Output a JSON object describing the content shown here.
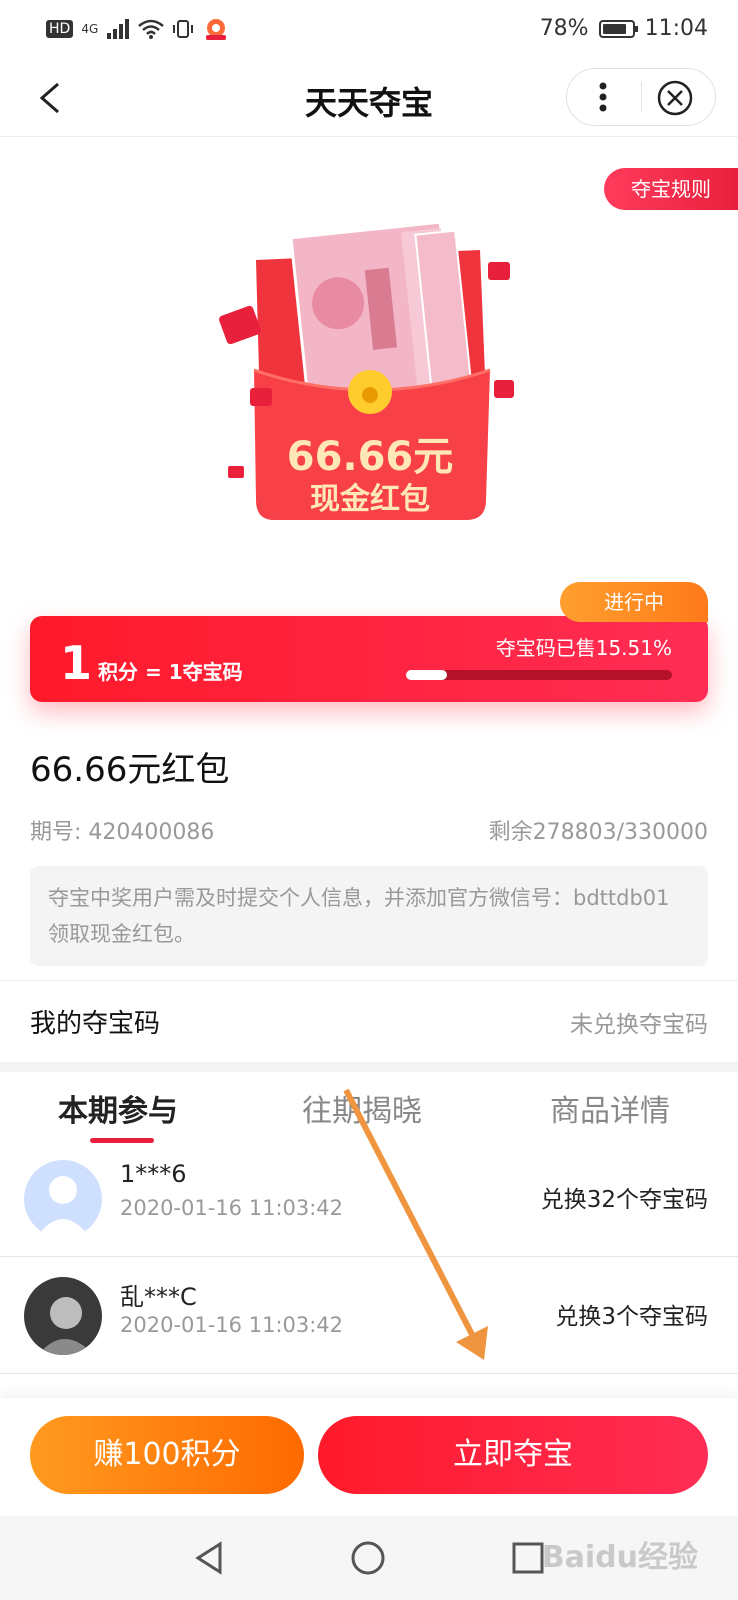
{
  "status_bar": {
    "network": "HD",
    "signal": "4G",
    "battery": "78%",
    "time": "11:04"
  },
  "nav": {
    "title": "天天夺宝"
  },
  "hero": {
    "rules_label": "夺宝规则",
    "amount": "66.66元",
    "caption": "现金红包"
  },
  "banner": {
    "status_tag": "进行中",
    "ratio_big": "1",
    "ratio_text": "积分 = 1夺宝码",
    "sold_text": "夺宝码已售15.51%",
    "sold_fraction": 0.1551
  },
  "item": {
    "title": "66.66元红包",
    "issue": "期号: 420400086",
    "remaining": "剩余278803/330000",
    "notice": "夺宝中奖用户需及时提交个人信息，并添加官方微信号：bdttdb01 领取现金红包。"
  },
  "my_codes": {
    "label": "我的夺宝码",
    "status": "未兑换夺宝码"
  },
  "tabs": [
    {
      "label": "本期参与"
    },
    {
      "label": "往期揭晓"
    },
    {
      "label": "商品详情"
    }
  ],
  "participants": [
    {
      "name": "1***6",
      "time": "2020-01-16 11:03:42",
      "codes": "兑换32个夺宝码"
    },
    {
      "name": "乱***C",
      "time": "2020-01-16 11:03:42",
      "codes": "兑换3个夺宝码"
    }
  ],
  "actions": {
    "earn": "赚100积分",
    "grab": "立即夺宝"
  },
  "watermark": "Baidu经验",
  "colors": {
    "accent_red": "#ff1a2a",
    "accent_orange": "#ff8a1a"
  }
}
